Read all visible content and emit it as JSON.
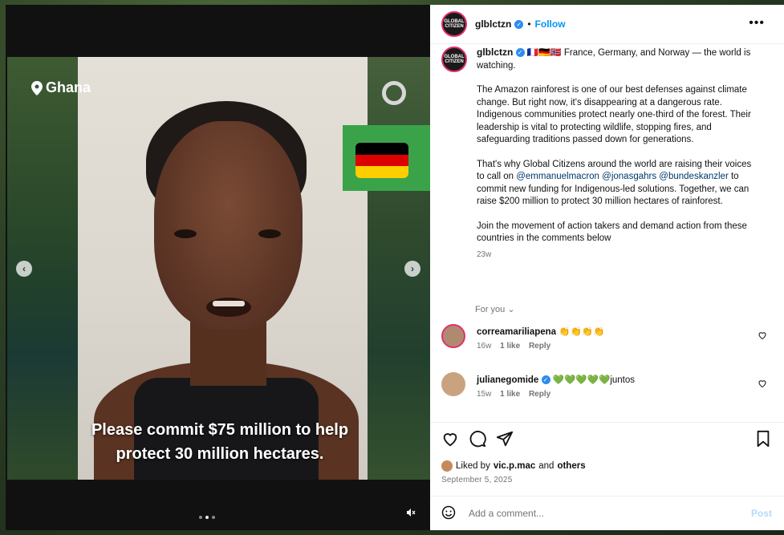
{
  "media": {
    "location": "Ghana",
    "caption_line1": "Please commit $75 million to help",
    "caption_line2": "protect 30 million hectares.",
    "flag_colors": [
      "#000000",
      "#dd0000",
      "#ffce00"
    ],
    "carousel_total": 3,
    "carousel_active": 2,
    "icons": [
      "location-pin-icon",
      "ring-icon",
      "chevron-left-icon",
      "chevron-right-icon",
      "mute-icon"
    ]
  },
  "header": {
    "avatar_text": "GLOBAL CITIZEN",
    "username": "glblctzn",
    "separator": "•",
    "follow_label": "Follow",
    "more_label": "•••"
  },
  "post": {
    "username": "glblctzn",
    "flags": "🇫🇷🇩🇪🇳🇴",
    "line1": "France, Germany, and Norway — the world is watching.",
    "para2": "The Amazon rainforest is one of our best defenses against climate change. But right now, it's disappearing at a dangerous rate. Indigenous communities protect nearly one-third of the forest. Their leadership is vital to protecting wildlife, stopping fires, and safeguarding traditions passed down for generations.",
    "para3_prefix": "That's why Global Citizens around the world are raising their voices to call on ",
    "mention1": "@emmanuelmacron",
    "mention2": "@jonasgahrs",
    "mention3": "@bundeskanzler",
    "para3_suffix": " to commit new funding for Indigenous-led solutions. Together, we can raise $200 million to protect 30 million hectares of rainforest.",
    "para4": "Join the movement of action takers and demand action from these countries in the comments below",
    "age": "23w"
  },
  "for_you": "For you",
  "comments": [
    {
      "username": "correamariliapena",
      "text": "👏👏👏👏",
      "age": "16w",
      "likes": "1 like",
      "reply": "Reply"
    },
    {
      "username": "julianegomide",
      "text": "💚💚💚💚💚juntos",
      "age": "15w",
      "likes": "1 like",
      "reply": "Reply"
    }
  ],
  "liked": {
    "prefix": "Liked by",
    "user": "vic.p.mac",
    "and": "and",
    "others": "others"
  },
  "date": "September 5, 2025",
  "add_comment": {
    "placeholder": "Add a comment...",
    "post_label": "Post"
  }
}
